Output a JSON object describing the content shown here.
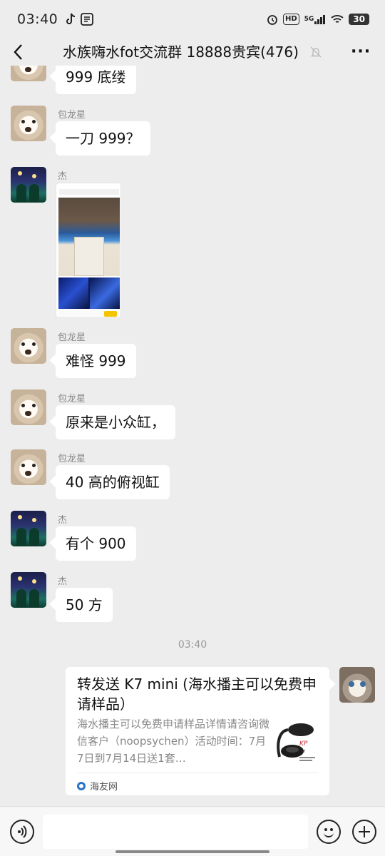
{
  "status_bar": {
    "time": "03:40",
    "hd_label": "HD",
    "network_label": "5G",
    "battery": "30"
  },
  "header": {
    "title": "水族嗨水fot交流群 18888贵宾(476)",
    "back_icon": "chevron-left-icon",
    "mute_icon": "bell-muted-icon",
    "more_icon": "more-icon",
    "more_label": "···"
  },
  "messages": [
    {
      "sender": "",
      "text": "999 底缕",
      "avatar": "dog"
    },
    {
      "sender": "包龙星",
      "text": "一刀 999？",
      "avatar": "dog"
    },
    {
      "sender": "杰",
      "type": "image",
      "avatar": "night"
    },
    {
      "sender": "包龙星",
      "text": "难怪 999",
      "avatar": "dog"
    },
    {
      "sender": "包龙星",
      "text": "原来是小众缸，",
      "avatar": "dog"
    },
    {
      "sender": "包龙星",
      "text": "40 高的俯视缸",
      "avatar": "dog"
    },
    {
      "sender": "杰",
      "text": "有个 900",
      "avatar": "night"
    },
    {
      "sender": "杰",
      "text": "50 方",
      "avatar": "night"
    }
  ],
  "time_divider": "03:40",
  "shared_card": {
    "title": "转发送 K7 mini (海水播主可以免费申请样品）",
    "description": "海水播主可以免费申请样品详情请咨询微信客户（noopsychen）活动时间：7月7日到7月14日送1套…",
    "source": "海友网"
  },
  "input_bar": {
    "placeholder": ""
  }
}
